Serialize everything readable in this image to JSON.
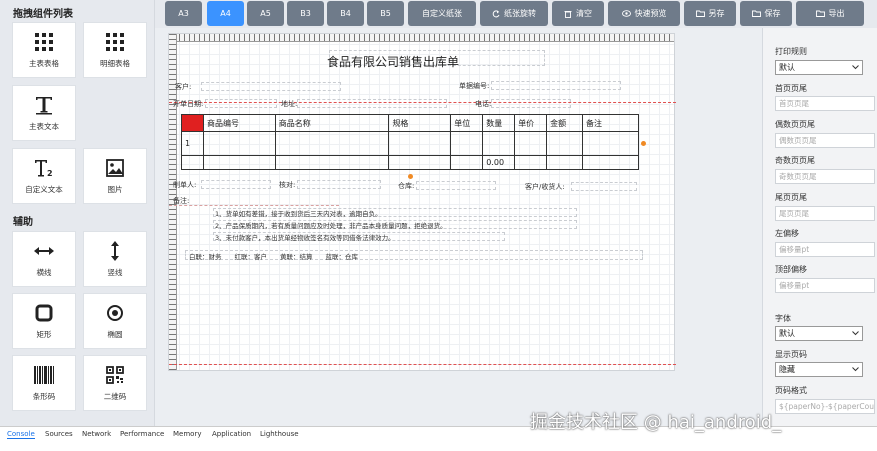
{
  "sidebar": {
    "section1": "拖拽组件列表",
    "section2": "辅助",
    "items": [
      {
        "label": "主表表格",
        "icon": "grid-icon"
      },
      {
        "label": "明细表格",
        "icon": "grid-icon"
      },
      {
        "label": "主表文本",
        "icon": "text-icon"
      },
      {
        "label": "自定义文本",
        "icon": "custom-text-icon"
      },
      {
        "label": "图片",
        "icon": "image-icon"
      },
      {
        "label": "横线",
        "icon": "horizontal-arrow-icon"
      },
      {
        "label": "竖线",
        "icon": "vertical-arrow-icon"
      },
      {
        "label": "矩形",
        "icon": "rectangle-icon"
      },
      {
        "label": "椭圆",
        "icon": "ellipse-icon"
      },
      {
        "label": "条形码",
        "icon": "barcode-icon"
      },
      {
        "label": "二维码",
        "icon": "qrcode-icon"
      }
    ]
  },
  "toolbar": {
    "sizes": [
      "A3",
      "A4",
      "A5",
      "B3",
      "B4",
      "B5"
    ],
    "active_size": "A4",
    "custom_paper": "自定义纸张",
    "rotate": "纸张旋转",
    "clear": "清空",
    "preview": "快速预览",
    "save_as": "另存",
    "save": "保存",
    "export": "导出"
  },
  "doc": {
    "title": "食品有限公司销售出库单",
    "customer": "客户:",
    "order_no": "单据编号:",
    "date": "开单日期:",
    "address": "地址:",
    "phone": "电话:",
    "table_headers": [
      "商品编号",
      "商品名称",
      "规格",
      "单位",
      "数量",
      "单价",
      "金额",
      "备注"
    ],
    "row_index": "1",
    "total_qty": "0.00",
    "maker": "制单人:",
    "reviewer": "核对:",
    "warehouse": "仓库:",
    "receiver": "客户/收货人:",
    "remark": "备注:",
    "notes": [
      "1、货单如有差错，接于收到货后三天内对表，逾期自负。",
      "2、产品保质期内，若有质量问题应及时处理，非产品本身质量问题，拒绝退货。",
      "3、未付款客户，本出货单经物收签名有效等同借条法律效力。"
    ],
    "copies": "白联：财务　　红联：客户　　黄联：结算　　蓝联：仓库"
  },
  "panel": {
    "print_rule_label": "打印规则",
    "print_rule_value": "默认",
    "first_header_label": "首页页尾",
    "first_header_ph": "首页页尾",
    "even_footer_label": "偶数页页尾",
    "even_footer_ph": "偶数页页尾",
    "odd_footer_label": "奇数页页尾",
    "odd_footer_ph": "奇数页页尾",
    "last_footer_label": "尾页页尾",
    "last_footer_ph": "尾页页尾",
    "left_offset_label": "左偏移",
    "left_offset_ph": "偏移量pt",
    "top_offset_label": "顶部偏移",
    "top_offset_ph": "偏移量pt",
    "font_label": "字体",
    "font_value": "默认",
    "show_page_label": "显示页码",
    "show_page_value": "隐藏",
    "page_format_label": "页码格式",
    "page_format_value": "${paperNo}-${paperCount}"
  },
  "devtools": {
    "tabs": [
      "Console",
      "Sources",
      "Network",
      "Performance",
      "Memory",
      "Application",
      "Lighthouse"
    ]
  },
  "watermark": "掘金技术社区 @ hai_android_",
  "colors": {
    "active": "#3b93ff",
    "button": "#6f7b8a",
    "accent_red": "#e02020",
    "dot": "#f08a24"
  }
}
